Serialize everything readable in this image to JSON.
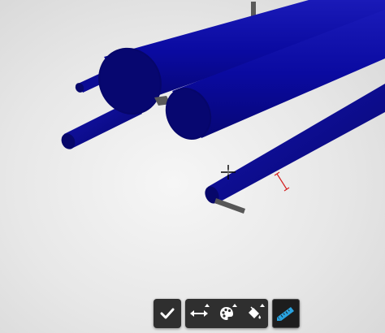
{
  "viewport": {
    "background": "#e4e4e4",
    "object_color": "#0a0a9c",
    "object_dark": "#060660",
    "support_color": "#555555",
    "measure_color": "#d42020"
  },
  "toolbar": {
    "confirm": {
      "icon": "check-icon"
    },
    "resize": {
      "icon": "arrows-horizontal-icon"
    },
    "appearance": {
      "icon": "palette-icon"
    },
    "fill": {
      "icon": "paint-bucket-icon"
    },
    "measure": {
      "icon": "ruler-icon",
      "active": true,
      "accent": "#29a3e0"
    }
  }
}
